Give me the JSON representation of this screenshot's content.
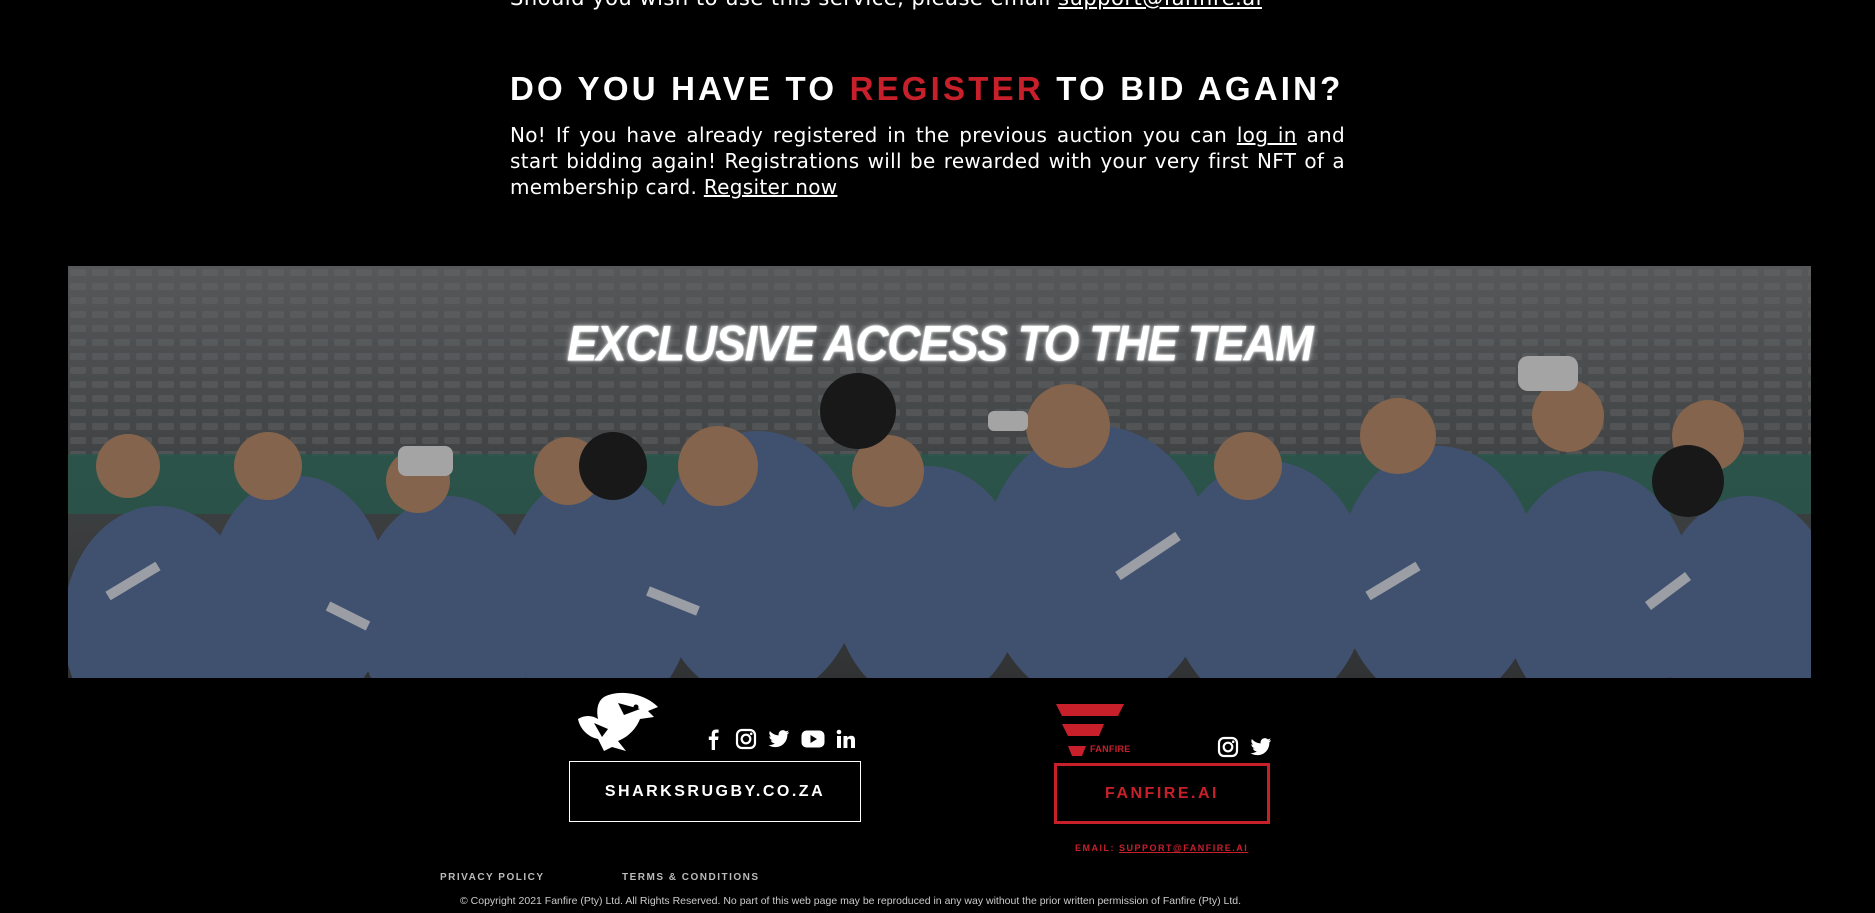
{
  "intro": {
    "text": "Should you wish to use this service, please email ",
    "email_link": "support@fanfire.ai"
  },
  "faq": {
    "heading_part1": "DO YOU HAVE TO ",
    "heading_accent": "REGISTER",
    "heading_part2": " TO BID AGAIN?",
    "para_1": "No! If you have already registered in the previous auction you can ",
    "login_link": "log in",
    "para_2": " and start bidding again! Registrations will be rewarded with your very first NFT of a membership card. ",
    "register_link": "Regsiter now"
  },
  "banner": {
    "title": "EXCLUSIVE ACCESS TO THE TEAM"
  },
  "footer": {
    "sharks_button": "SHARKSRUGBY.CO.ZA",
    "sharks_social": [
      "facebook-icon",
      "instagram-icon",
      "twitter-icon",
      "youtube-icon",
      "linkedin-icon"
    ],
    "fanfire_logo_text": "FANFIRE",
    "fanfire_social": [
      "instagram-icon",
      "twitter-icon"
    ],
    "fanfire_button": "FANFIRE.AI",
    "email_label": "EMAIL: ",
    "email_link": "SUPPORT@FANFIRE.AI",
    "privacy": "PRIVACY POLICY",
    "terms": "TERMS & CONDITIONS",
    "copyright": "©   Copyright 2021 Fanfire (Pty) Ltd. All Rights Reserved. No part of this web page may be reproduced in any way without the prior written permission of Fanfire (Pty) Ltd."
  },
  "colors": {
    "accent": "#c8202b",
    "background": "#000000",
    "jersey": "#5b6f93"
  }
}
